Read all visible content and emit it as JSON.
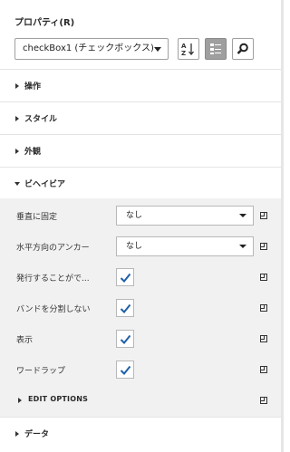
{
  "panel": {
    "title": "プロパティ(R)"
  },
  "toolbar": {
    "selected_object": "checkBox1 (チェックボックス)",
    "sort_icon": "sort-az-icon",
    "categorized_icon": "categorized-view-icon",
    "search_icon": "search-icon"
  },
  "sections": {
    "operation": "操作",
    "style": "スタイル",
    "appearance": "外観",
    "behavior": "ビヘイビア",
    "data": "データ"
  },
  "behavior_props": [
    {
      "label": "垂直に固定",
      "type": "dropdown",
      "value": "なし"
    },
    {
      "label": "水平方向のアンカー",
      "type": "dropdown",
      "value": "なし"
    },
    {
      "label": "発行することがで...",
      "type": "checkbox",
      "checked": true
    },
    {
      "label": "バンドを分割しない",
      "type": "checkbox",
      "checked": true
    },
    {
      "label": "表示",
      "type": "checkbox",
      "checked": true
    },
    {
      "label": "ワードラップ",
      "type": "checkbox",
      "checked": true
    }
  ],
  "edit_options": {
    "label": "EDIT OPTIONS"
  },
  "colors": {
    "accent_check": "#1f5fa8",
    "expanded_bg": "#f1f1f1",
    "active_button": "#9f9f9f"
  }
}
